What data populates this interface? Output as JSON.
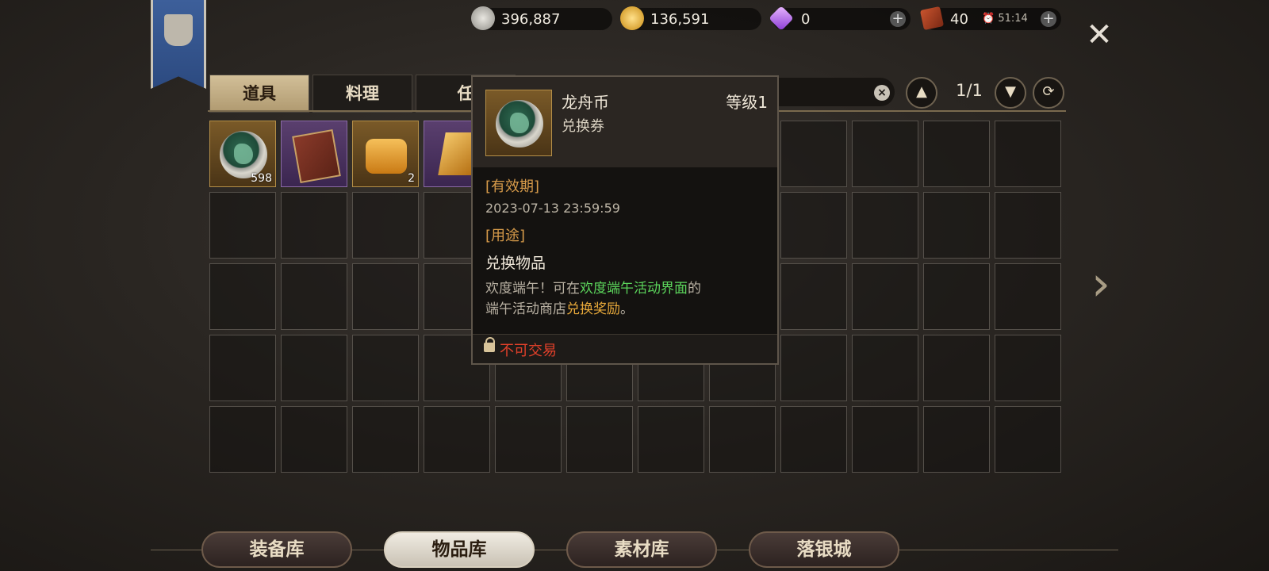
{
  "currency": {
    "silver": "396,887",
    "gold": "136,591",
    "diamond": "0",
    "stamina": "40",
    "timer": "51:14"
  },
  "top_tabs": [
    "道具",
    "料理",
    "任"
  ],
  "pager": {
    "page": "1/1"
  },
  "items": [
    {
      "kind": "coin",
      "count": "598",
      "rarity": "gold"
    },
    {
      "kind": "book",
      "count": "",
      "rarity": "purple"
    },
    {
      "kind": "gold-bar",
      "count": "2",
      "rarity": "gold"
    },
    {
      "kind": "gem",
      "count": "",
      "rarity": "purple"
    }
  ],
  "tooltip": {
    "name": "龙舟币",
    "type": "兑换券",
    "level": "等级1",
    "expiry_label": "[有效期]",
    "expiry": "2023-07-13 23:59:59",
    "use_label": "[用途]",
    "use": "兑换物品",
    "desc_1": "欢度端午！可在",
    "desc_2": "欢度端午活动界面",
    "desc_3": "的",
    "desc_4": "端午活动商店",
    "desc_5": "兑换奖励",
    "desc_6": "。",
    "trade": "不可交易"
  },
  "bottom_tabs": [
    "装备库",
    "物品库",
    "素材库",
    "落银城"
  ],
  "icons": [
    "banner-emblem-icon",
    "silver-coin-icon",
    "gold-coin-icon",
    "diamond-icon",
    "stamina-book-icon",
    "alarm-icon",
    "plus-icon",
    "close-icon",
    "clear-icon",
    "up-arrow-icon",
    "down-arrow-icon",
    "refresh-icon",
    "lock-icon",
    "chevron-right-icon"
  ],
  "colors": {
    "highlight_green": "#5bd45b",
    "highlight_orange": "#e8a93a",
    "untradeable_red": "#e0402a"
  }
}
